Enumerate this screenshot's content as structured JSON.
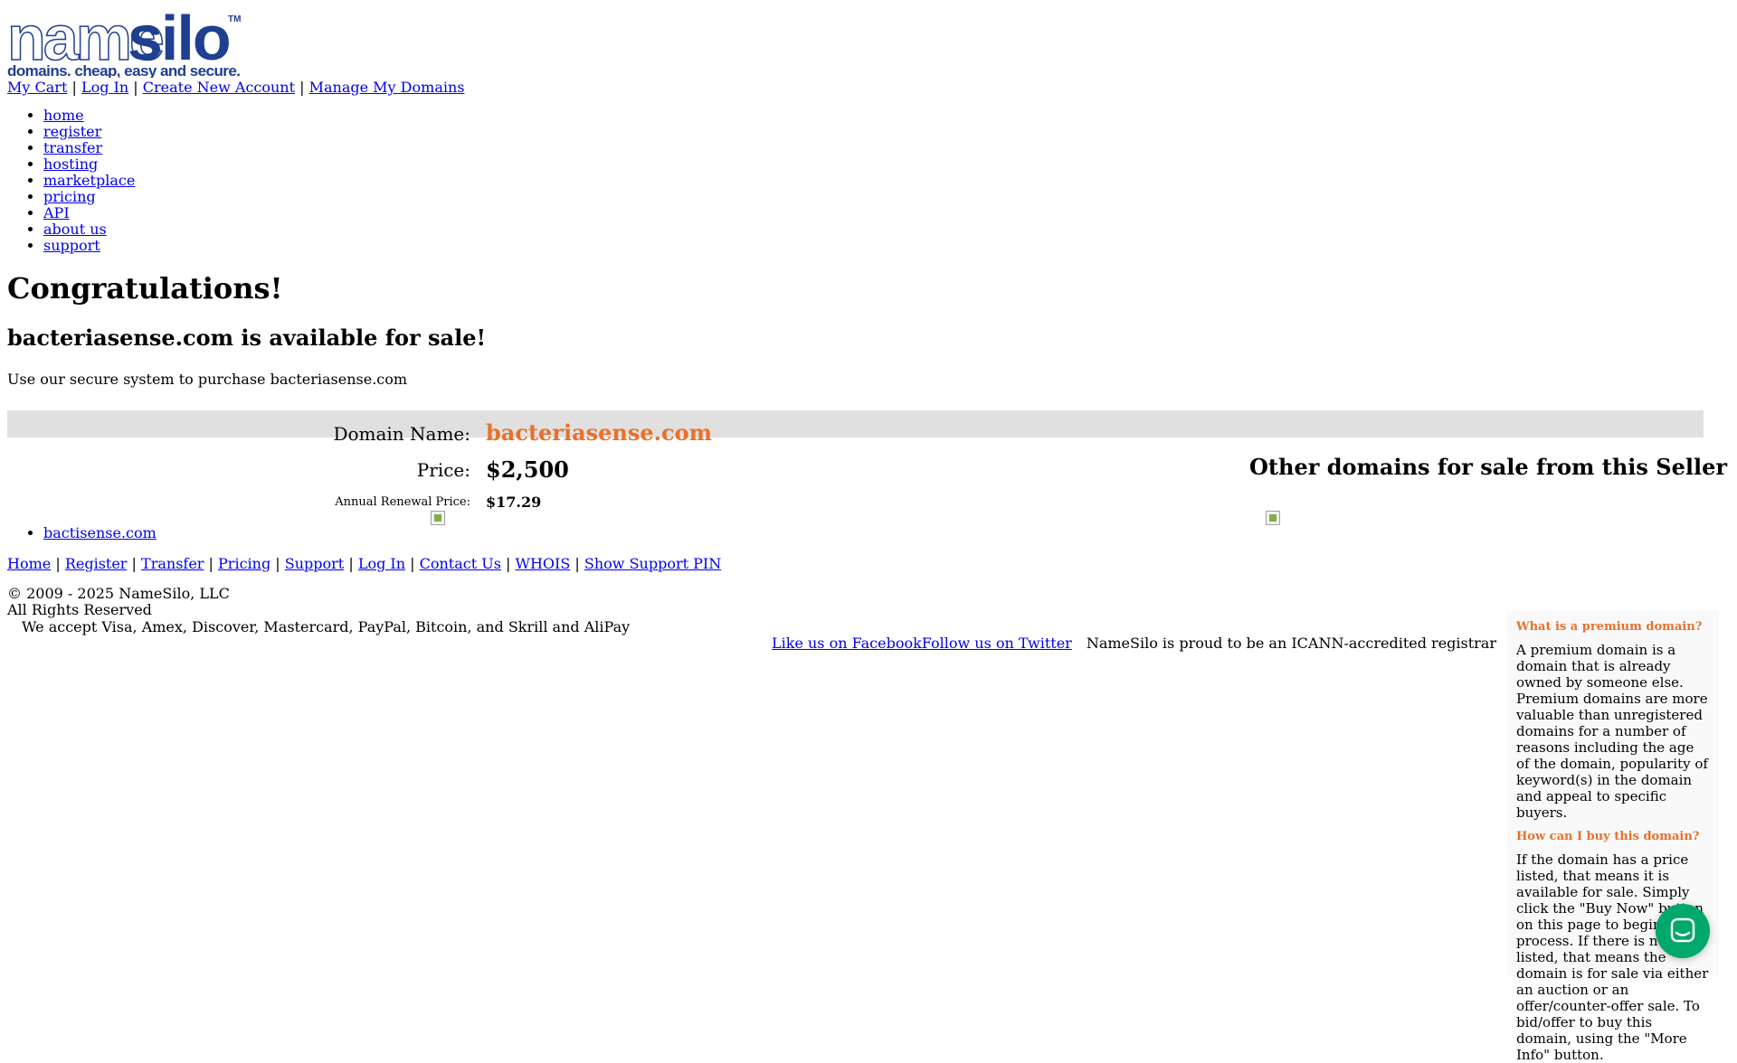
{
  "logo": {
    "wordmark_a": "name",
    "wordmark_b": "silo",
    "tm": "TM",
    "tagline": "domains. cheap, easy and secure."
  },
  "top_links": [
    {
      "label": "My Cart"
    },
    {
      "label": "Log In"
    },
    {
      "label": "Create New Account"
    },
    {
      "label": "Manage My Domains"
    }
  ],
  "separator": "|",
  "nav": [
    {
      "label": "home"
    },
    {
      "label": "register"
    },
    {
      "label": "transfer"
    },
    {
      "label": "hosting"
    },
    {
      "label": "marketplace"
    },
    {
      "label": "pricing"
    },
    {
      "label": "API"
    },
    {
      "label": "about us"
    },
    {
      "label": "support"
    }
  ],
  "main": {
    "heading": "Congratulations!",
    "subheading": "bacteriasense.com is available for sale!",
    "intro": "Use our secure system to purchase bacteriasense.com",
    "domain_label": "Domain Name:",
    "domain_value": "bacteriasense.com",
    "price_label": "Price:",
    "price_value": "$2,500",
    "renewal_label": "Annual Renewal Price:",
    "renewal_value": "$17.29",
    "other_heading": "Other domains for sale from this Seller",
    "other_domains": [
      {
        "label": "bactisense.com"
      }
    ]
  },
  "footer": {
    "links": [
      {
        "label": "Home"
      },
      {
        "label": "Register"
      },
      {
        "label": "Transfer"
      },
      {
        "label": "Pricing"
      },
      {
        "label": "Support"
      },
      {
        "label": "Log In"
      },
      {
        "label": "Contact Us"
      },
      {
        "label": "WHOIS"
      },
      {
        "label": "Show Support PIN"
      }
    ],
    "copyright": "© 2009 - 2025 NameSilo, LLC",
    "rights": "All Rights Reserved",
    "payments_alt": "We accept Visa, Amex, Discover, Mastercard, PayPal, Bitcoin, and Skrill and AliPay",
    "facebook": "Like us on Facebook",
    "twitter": "Follow us on Twitter",
    "icann_alt": "NameSilo is proud to be an ICANN-accredited registrar"
  },
  "faq": [
    {
      "q": "What is a premium domain?",
      "a": "A premium domain is a domain that is already owned by someone else. Premium domains are more valuable than unregistered domains for a number of reasons including the age of the domain, popularity of keyword(s) in the domain and appeal to specific buyers."
    },
    {
      "q": "How can I buy this domain?",
      "a": "If the domain has a price listed, that means it is available for sale. Simply click the \"Buy Now\" button on this page to begin the process. If there is no price listed, that means the domain is for sale via either an auction or an offer/counter-offer sale. To bid/offer to buy this domain, using the \"More Info\" button."
    }
  ],
  "colors": {
    "accent": "#e8702a",
    "link": "#0000ee",
    "logo_blue": "#1f3f8f",
    "chat": "#00a86b"
  },
  "icons": {
    "chat": "chat-bubble-icon",
    "broken_image": "broken-image-icon"
  }
}
